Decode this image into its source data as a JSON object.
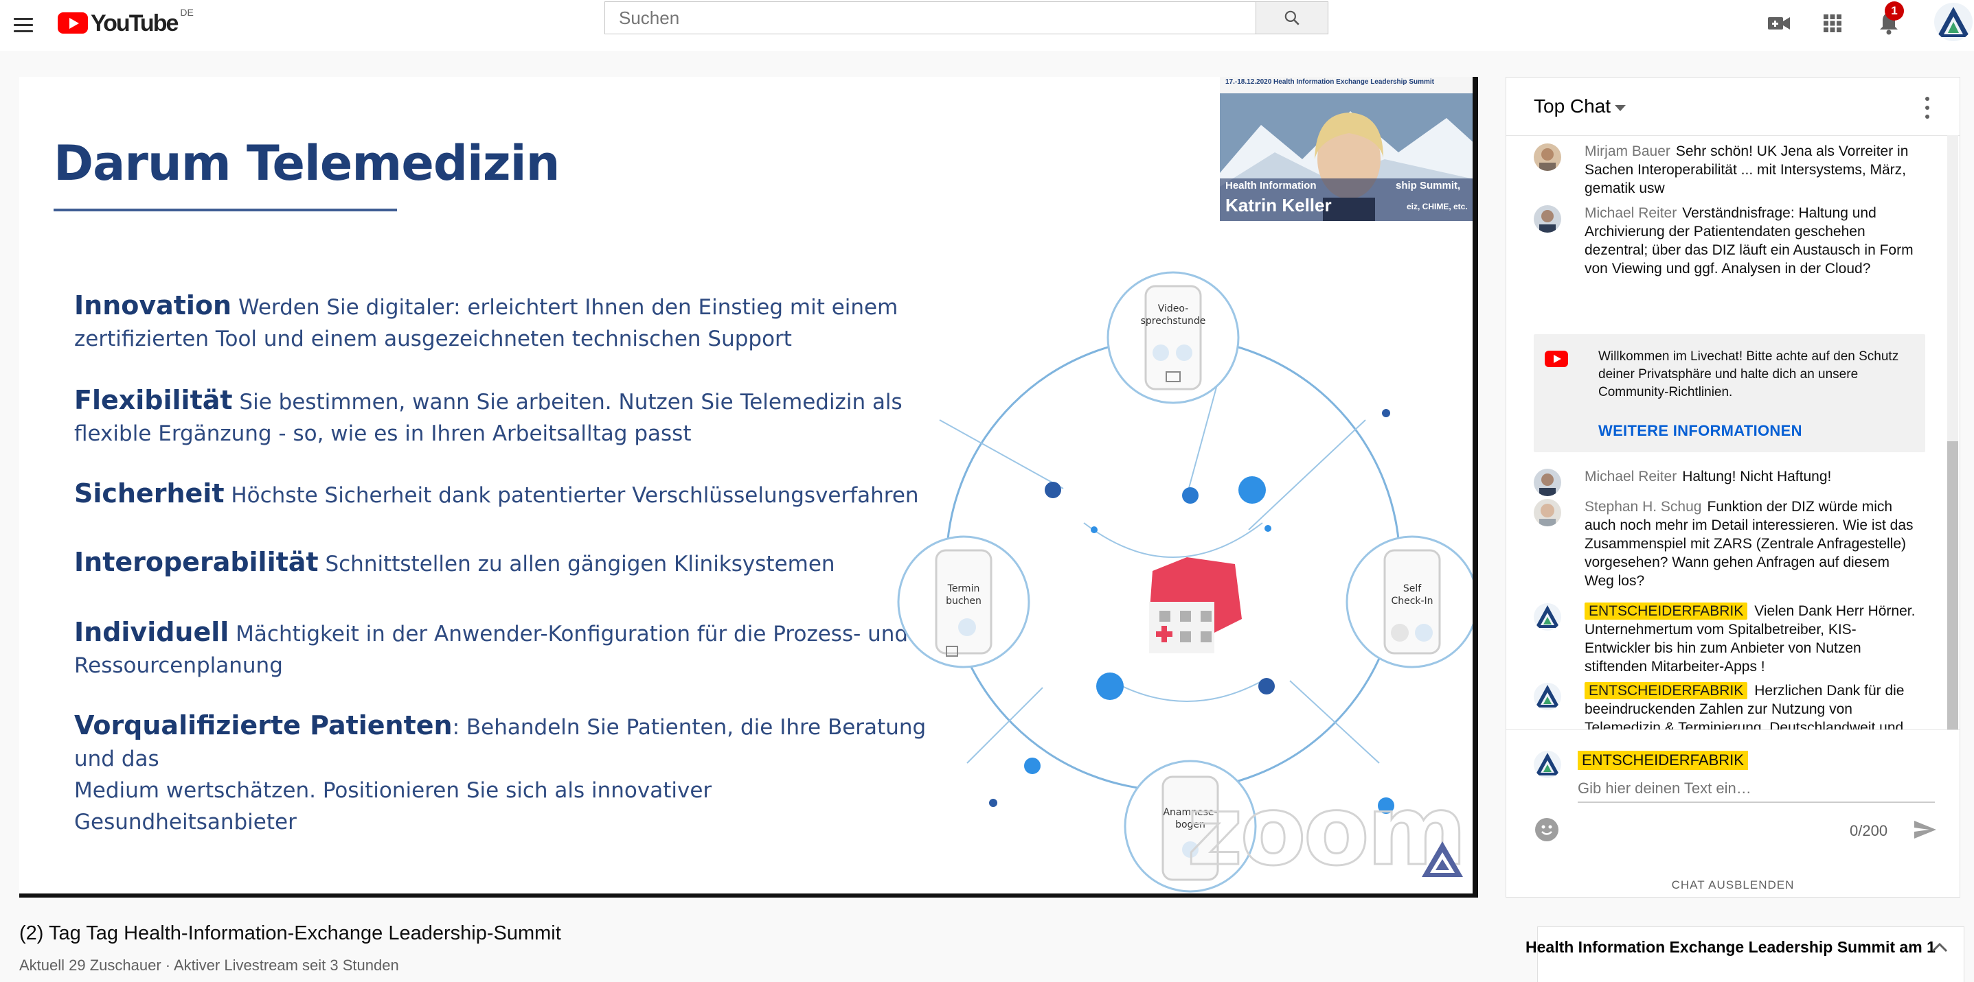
{
  "header": {
    "logo_text": "YouTube",
    "region": "DE",
    "search_placeholder": "Suchen",
    "notification_count": "1"
  },
  "slide": {
    "title": "Darum Telemedizin",
    "bullets": [
      {
        "term": "Innovation",
        "line1": " Werden Sie digitaler: erleichtert Ihnen den Einstieg mit einem",
        "line2": "zertifizierten Tool und einem ausgezeichneten technischen Support"
      },
      {
        "term": "Flexibilität",
        "line1": " Sie bestimmen, wann Sie arbeiten. Nutzen Sie Telemedizin als",
        "line2": "flexible Ergänzung - so, wie es in Ihren Arbeitsalltag passt"
      },
      {
        "term": "Sicherheit",
        "line1": " Höchste Sicherheit dank patentierter Verschlüsselungsverfahren",
        "line2": ""
      },
      {
        "term": "Interoperabilität",
        "line1": " Schnittstellen zu allen gängigen Kliniksystemen",
        "line2": ""
      },
      {
        "term": "Individuell",
        "line1": " Mächtigkeit in der Anwender-Konfiguration für die Prozess- und",
        "line2": "Ressourcenplanung"
      },
      {
        "term": "Vorqualifizierte Patienten",
        "line1": ": Behandeln Sie Patienten, die Ihre Beratung und das",
        "line2": "Medium wertschätzen. Positionieren Sie sich als innovativer Gesundheitsanbieter"
      }
    ],
    "diagram_labels": {
      "video": "Video-\nsprechstunde",
      "termin": "Termin\nbuchen",
      "self": "Self\nCheck-In",
      "anamnese": "Anamnese-\nbogen"
    },
    "pip": {
      "banner": "17.-18.12.2020 Health Information Exchange Leadership Summit",
      "subtitle_left": "Health Information",
      "subtitle_right": "ship Summit,",
      "name": "Katrin Keller",
      "tag_right": "eiz, CHIME, etc."
    },
    "watermark": "zoom"
  },
  "chat": {
    "title": "Top Chat",
    "messages": [
      {
        "author": "Mirjam Bauer",
        "text": "Sehr schön! UK Jena als Vorreiter in Sachen Interoperabilität ... mit Intersystems, März, gematik usw"
      },
      {
        "author": "Michael Reiter",
        "text": "Verständnisfrage: Haltung und Archivierung der Patientendaten geschehen dezentral; über das DIZ läuft ein Austausch in Form von Viewing und ggf. Analysen in der Cloud?"
      },
      {
        "author": "Michael Reiter",
        "text": "Haltung! Nicht Haftung!"
      },
      {
        "author": "Stephan H. Schug",
        "text": "Funktion der DIZ würde mich auch noch mehr im Detail interessieren. Wie ist das Zusammenspiel mit ZARS (Zentrale Anfragestelle) vorgesehen? Wann gehen Anfragen auf diesem Weg los?"
      },
      {
        "author": "ENTSCHEIDERFABRIK",
        "text": "Vielen Dank Herr Hörner. Unternehmertum vom Spitalbetreiber, KIS-Entwickler bis hin zum Anbieter von Nutzen stiftenden Mitarbeiter-Apps !"
      },
      {
        "author": "ENTSCHEIDERFABRIK",
        "text": "Herzlichen Dank für die beeindruckenden Zahlen zur Nutzung von Telemedizin & Terminierung, Deutschlandweit und im Universitätsklinikum Erlangen, Frau Katrin Keller und Martin Schneider!"
      }
    ],
    "welcome": {
      "text": "Willkommen im Livechat! Bitte achte auf den Schutz deiner Privatsphäre und halte dich an unsere Community-Richtlinien.",
      "link": "WEITERE INFORMATIONEN"
    },
    "input": {
      "author": "ENTSCHEIDERFABRIK",
      "placeholder": "Gib hier deinen Text ein…",
      "counter": "0/200"
    },
    "hide_label": "CHAT AUSBLENDEN"
  },
  "video": {
    "title": "(2) Tag Tag Health-Information-Exchange Leadership-Summit",
    "meta": "Aktuell 29 Zuschauer · Aktiver Livestream seit 3 Stunden"
  },
  "playlist": {
    "title": "Health Information Exchange Leadership Summit am 1"
  },
  "colors": {
    "brand_red": "#ff0000",
    "slide_blue": "#1f3f78",
    "owner_badge": "#ffd600",
    "link_blue": "#065fd4"
  }
}
